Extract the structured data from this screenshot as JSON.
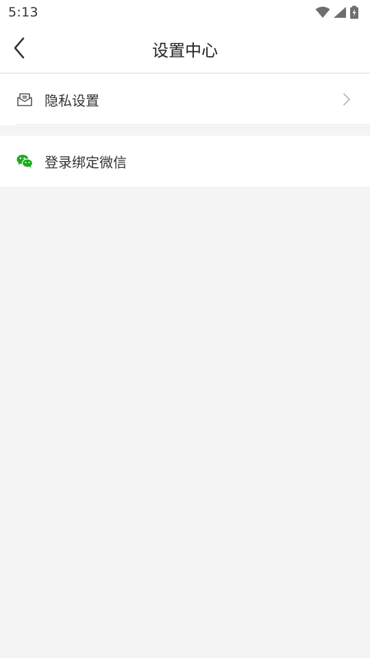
{
  "status_bar": {
    "time": "5:13",
    "icons": [
      "wifi-icon",
      "cellular-signal-icon",
      "battery-charging-icon"
    ]
  },
  "header": {
    "title": "设置中心",
    "back_icon": "chevron-left-icon"
  },
  "settings": {
    "items": [
      {
        "label": "隐私设置",
        "icon": "envelope-icon",
        "has_chevron": true
      },
      {
        "label": "登录绑定微信",
        "icon": "wechat-icon",
        "has_chevron": false
      }
    ]
  },
  "colors": {
    "background": "#f4f4f4",
    "surface": "#ffffff",
    "wechat_green": "#1aad19",
    "text_primary": "#333333",
    "chevron": "#b0b0b0"
  }
}
